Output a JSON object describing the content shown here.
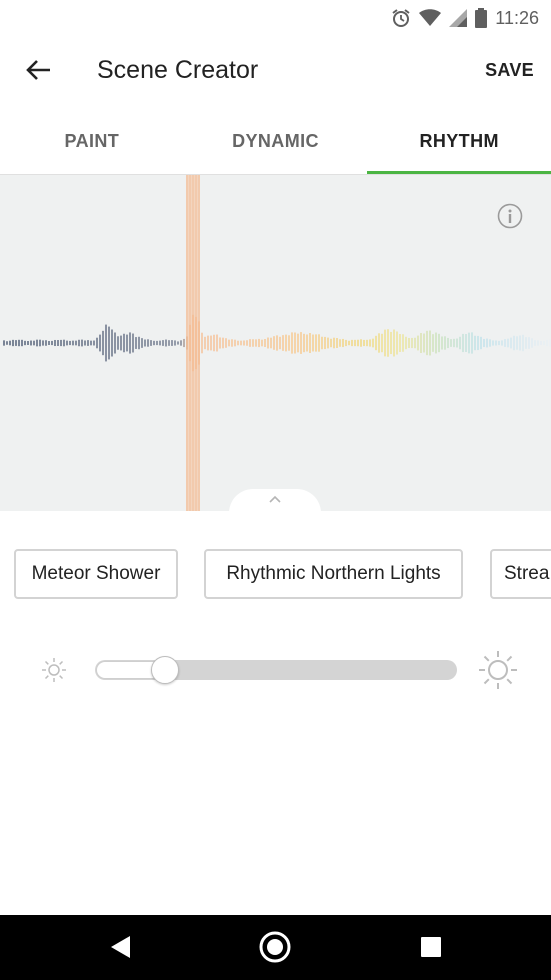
{
  "status_bar": {
    "time": "11:26",
    "icons": [
      "alarm-icon",
      "wifi-icon",
      "signal-icon",
      "battery-icon"
    ]
  },
  "app_bar": {
    "title": "Scene Creator",
    "save_label": "SAVE",
    "back_icon": "arrow-left-icon"
  },
  "tabs": [
    {
      "label": "PAINT",
      "active": false
    },
    {
      "label": "DYNAMIC",
      "active": false
    },
    {
      "label": "RHYTHM",
      "active": true
    }
  ],
  "accent_color": "#4bb543",
  "waveform": {
    "info_icon": "info-icon",
    "handle_icon": "chevron-up-icon"
  },
  "scenes": [
    {
      "label": "Meteor Shower"
    },
    {
      "label": "Rhythmic Northern Lights"
    },
    {
      "label": "Strea"
    }
  ],
  "brightness": {
    "min_icon": "sun-small-icon",
    "max_icon": "sun-large-icon",
    "value": 0.19
  },
  "nav_bar": {
    "icons": [
      "back-triangle-icon",
      "home-circle-icon",
      "recents-square-icon"
    ]
  }
}
